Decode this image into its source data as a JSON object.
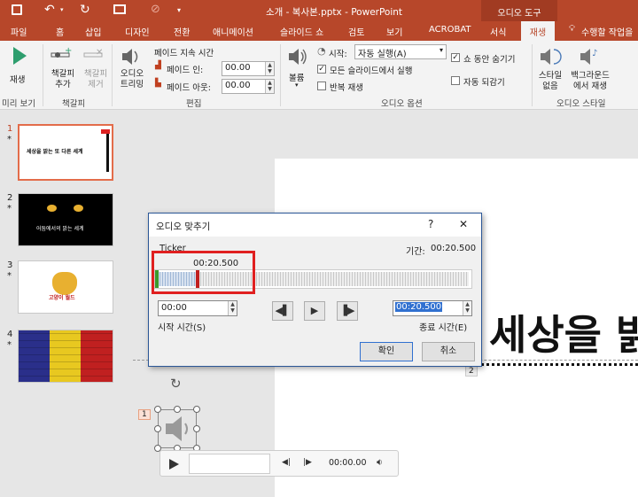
{
  "titlebar": {
    "title": "소개 - 복사본.pptx - PowerPoint",
    "context_tab": "오디오 도구"
  },
  "tabs": [
    "파일",
    "홈",
    "삽입",
    "디자인",
    "전환",
    "애니메이션",
    "슬라이드 쇼",
    "검토",
    "보기",
    "ACROBAT",
    "서식",
    "재생"
  ],
  "tell_me": "수행할 작업을",
  "ribbon": {
    "play_label": "재생",
    "add_bookmark": "책갈피 추가",
    "remove_bookmark": "책갈피 제거",
    "trim_audio": "오디오 트리밍",
    "fade_duration": "페이드 지속 시간",
    "fade_in_label": "페이드 인:",
    "fade_in_value": "00.00",
    "fade_out_label": "페이드 아웃:",
    "fade_out_value": "00.00",
    "volume": "볼륨",
    "start_label": "시작:",
    "start_value": "자동 실행(A)",
    "play_across": "모든 슬라이드에서 실행",
    "loop": "반복 재생",
    "hide_during_show": "쇼 동안 숨기기",
    "rewind": "자동 되감기",
    "no_style": "스타일 없음",
    "play_in_bg": "백그라운드에서 재생",
    "groups": {
      "preview": "미리 보기",
      "bookmarks": "책갈피",
      "editing": "편집",
      "audio_options": "오디오 옵션",
      "audio_styles": "오디오 스타일"
    }
  },
  "slides": [
    {
      "num": "1",
      "star": "*",
      "text": "세상을 밝는 또 다른 세계"
    },
    {
      "num": "2",
      "star": "*",
      "text": "어둠에서의 밝는 세계"
    },
    {
      "num": "3",
      "star": "*",
      "text": "고양이 월드"
    },
    {
      "num": "4",
      "star": "*",
      "text": ""
    }
  ],
  "slide_text": "세상을 밝",
  "audio_anim_number": "1",
  "placeholder_number": "2",
  "player": {
    "time": "00:00.00"
  },
  "dialog": {
    "title": "오디오 맞추기",
    "help": "?",
    "close": "✕",
    "track_name": "Ticker",
    "duration_label": "기간:",
    "duration_value": "00:20.500",
    "marker_time": "00:20.500",
    "start_value": "00:00",
    "start_label": "시작 시간(S)",
    "end_value": "00:20.500",
    "end_label": "종료 시간(E)",
    "ok": "확인",
    "cancel": "취소"
  }
}
